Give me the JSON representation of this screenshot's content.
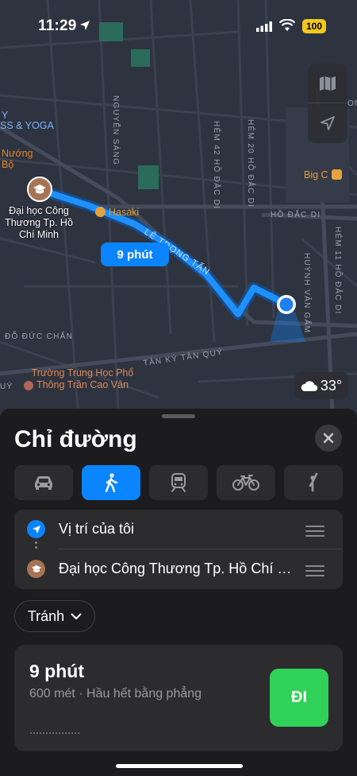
{
  "status": {
    "time": "11:29",
    "battery": "100"
  },
  "map": {
    "labels": {
      "yoga": "SS & YOGA",
      "yoga_prefix": "Y",
      "nuong": "Nướng",
      "bo": "Bộ",
      "hasaki": "Hasaki",
      "bigc": "Big C",
      "univ": "Đại học Công Thương Tp. Hồ Chí Minh",
      "school": "Trường Trung Học Phổ Thông Trần Cao Vân",
      "edge_right": "ONG"
    },
    "streets": {
      "nguyen_sang": "NGUYỄN SÁNG",
      "hem42": "HẺM 42 HỒ ĐẮC DI",
      "hem20": "HẺM 20 HỒ ĐẮC DI",
      "ho_dac_di": "HỒ ĐẮC DI",
      "le_trong_tan": "LÊ TRỌNG TẤN",
      "huynh_van_gam": "HUỲNH VĂN GẤM",
      "hem11": "HẺM 11 HỒ ĐẮC DI",
      "do_duc_chan": "ĐỖ ĐỨC CHẨN",
      "tan_ky_tan_quy": "TÂN KỲ TÂN QUÝ",
      "uy": "UÝ"
    },
    "route_badge": "9 phút",
    "temperature": "33°"
  },
  "sheet": {
    "title": "Chỉ đường",
    "modes": [
      {
        "name": "drive",
        "icon": "car-icon",
        "active": false
      },
      {
        "name": "walk",
        "icon": "walking-icon",
        "active": true
      },
      {
        "name": "transit",
        "icon": "train-icon",
        "active": false
      },
      {
        "name": "cycle",
        "icon": "bicycle-icon",
        "active": false
      },
      {
        "name": "rideshare",
        "icon": "person-waving-icon",
        "active": false
      }
    ],
    "from": "Vị trí của tôi",
    "to": "Đại học Công Thương Tp. Hồ Chí Minh",
    "avoid": "Tránh",
    "route": {
      "time": "9 phút",
      "detail": "600 mét · Hầu hết bằng phẳng",
      "go": "ĐI"
    }
  },
  "colors": {
    "accent": "#0a84ff",
    "go": "#30d158",
    "map_bg": "#2e3340"
  }
}
